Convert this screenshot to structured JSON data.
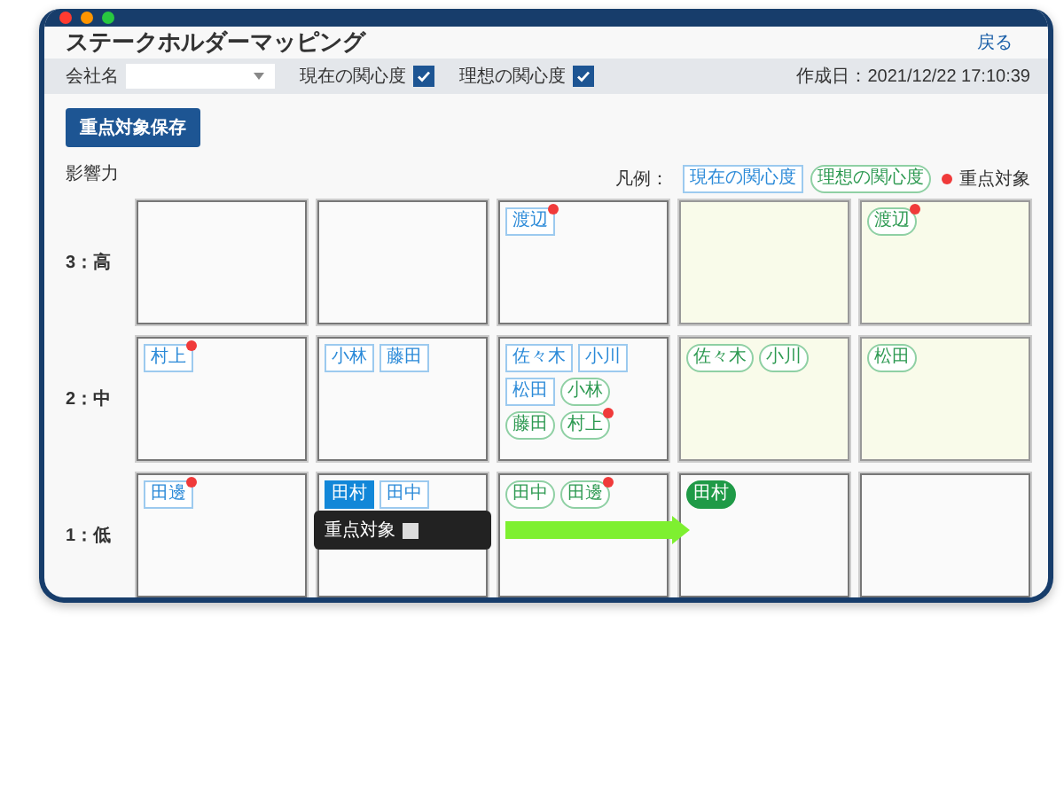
{
  "window": {
    "title": "ステークホルダーマッピング",
    "back_link": "戻る"
  },
  "filters": {
    "company": {
      "label": "会社名"
    },
    "toggles": [
      {
        "label": "現在の関心度",
        "checked": true
      },
      {
        "label": "理想の関心度",
        "checked": true
      }
    ],
    "created": "作成日：2021/12/22 17:10:39"
  },
  "save_button": "重点対象保存",
  "axis_label": "影響力",
  "legend": {
    "title": "凡例：",
    "current": "現在の関心度",
    "ideal": "理想の関心度",
    "focus": "重点対象"
  },
  "rows": [
    {
      "label": "3：高",
      "cells": [
        {
          "highlight": false
        },
        {
          "highlight": false
        },
        {
          "highlight": false,
          "tags": [
            {
              "name": "渡辺",
              "kind": "current",
              "focus": true,
              "selected": false
            }
          ]
        },
        {
          "highlight": true
        },
        {
          "highlight": true,
          "tags": [
            {
              "name": "渡辺",
              "kind": "ideal",
              "focus": true,
              "selected": false
            }
          ]
        }
      ]
    },
    {
      "label": "2：中",
      "cells": [
        {
          "highlight": false,
          "tags": [
            {
              "name": "村上",
              "kind": "current",
              "focus": true,
              "selected": false
            }
          ]
        },
        {
          "highlight": false,
          "tags": [
            {
              "name": "小林",
              "kind": "current",
              "focus": false,
              "selected": false
            },
            {
              "name": "藤田",
              "kind": "current",
              "focus": false,
              "selected": false
            }
          ]
        },
        {
          "highlight": false,
          "tags": [
            {
              "name": "佐々木",
              "kind": "current",
              "focus": false,
              "selected": false
            },
            {
              "name": "小川",
              "kind": "current",
              "focus": false,
              "selected": false
            },
            {
              "name": "松田",
              "kind": "current",
              "focus": false,
              "selected": false
            },
            {
              "name": "小林",
              "kind": "ideal",
              "focus": false,
              "selected": false
            },
            {
              "name": "藤田",
              "kind": "ideal",
              "focus": false,
              "selected": false
            },
            {
              "name": "村上",
              "kind": "ideal",
              "focus": true,
              "selected": false
            }
          ]
        },
        {
          "highlight": true,
          "tags": [
            {
              "name": "佐々木",
              "kind": "ideal",
              "focus": false,
              "selected": false
            },
            {
              "name": "小川",
              "kind": "ideal",
              "focus": false,
              "selected": false
            }
          ]
        },
        {
          "highlight": true,
          "tags": [
            {
              "name": "松田",
              "kind": "ideal",
              "focus": false,
              "selected": false
            }
          ]
        }
      ]
    },
    {
      "label": "1：低",
      "cells": [
        {
          "highlight": false,
          "tags": [
            {
              "name": "田邊",
              "kind": "current",
              "focus": true,
              "selected": false
            }
          ]
        },
        {
          "highlight": false,
          "tags": [
            {
              "name": "田村",
              "kind": "current",
              "focus": false,
              "selected": true
            },
            {
              "name": "田中",
              "kind": "current",
              "focus": false,
              "selected": false
            }
          ]
        },
        {
          "highlight": false,
          "tags": [
            {
              "name": "田中",
              "kind": "ideal",
              "focus": false,
              "selected": false
            },
            {
              "name": "田邊",
              "kind": "ideal",
              "focus": true,
              "selected": false
            }
          ]
        },
        {
          "highlight": false,
          "tags": [
            {
              "name": "田村",
              "kind": "ideal",
              "focus": false,
              "selected": true
            }
          ]
        },
        {
          "highlight": false
        }
      ]
    }
  ],
  "tooltip": {
    "label": "重点対象",
    "checked": false
  }
}
